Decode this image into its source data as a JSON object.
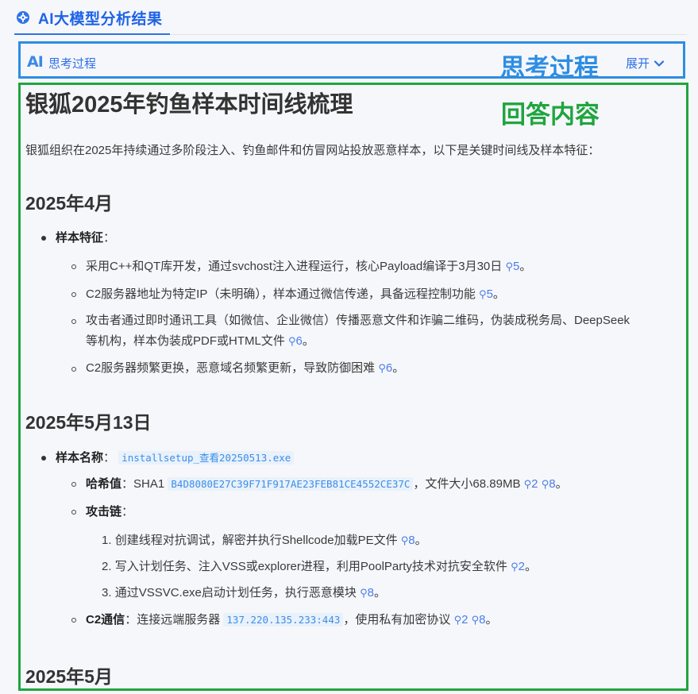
{
  "tab": {
    "title": "AI大模型分析结果",
    "icon": "gear-icon"
  },
  "thinking": {
    "ai_badge": "AI",
    "label": "思考过程",
    "annotation": "思考过程",
    "expand_label": "展开",
    "expand_icon": "chevron-down-icon"
  },
  "answer": {
    "annotation": "回答内容",
    "title": "银狐2025年钓鱼样本时间线梳理",
    "intro": "银狐组织在2025年持续通过多阶段注入、钓鱼邮件和仿冒网站投放恶意样本，以下是关键时间线及样本特征：",
    "sections": [
      {
        "heading": "2025年4月",
        "item_label": "样本特征",
        "items": [
          {
            "text": "采用C++和QT库开发，通过svchost注入进程运行，核心Payload编译于3月30日",
            "cites": [
              "5"
            ]
          },
          {
            "text": "C2服务器地址为特定IP（未明确），样本通过微信传递，具备远程控制功能",
            "cites": [
              "5"
            ]
          },
          {
            "text_line1": "攻击者通过即时通讯工具（如微信、企业微信）传播恶意文件和诈骗二维码，伪装成税务局、DeepSeek",
            "text_line2": "等机构，样本伪装成PDF或HTML文件",
            "cites": [
              "6"
            ]
          },
          {
            "text": "C2服务器频繁更换，恶意域名频繁更新，导致防御困难",
            "cites": [
              "6"
            ]
          }
        ]
      },
      {
        "heading": "2025年5月13日",
        "name_label": "样本名称",
        "name_value": "installsetup_查看20250513.exe",
        "hash_label": "哈希值",
        "hash_prefix": "SHA1",
        "hash_value": "B4D8080E27C39F71F917AE23FEB81CE4552CE37C",
        "hash_suffix": "，文件大小68.89MB",
        "hash_cites": [
          "2",
          "8"
        ],
        "chain_label": "攻击链",
        "chain": [
          {
            "num": "1.",
            "text": "创建线程对抗调试，解密并执行Shellcode加载PE文件",
            "cites": [
              "8"
            ]
          },
          {
            "num": "2.",
            "text": "写入计划任务、注入VSS或explorer进程，利用PoolParty技术对抗安全软件",
            "cites": [
              "2"
            ]
          },
          {
            "num": "3.",
            "text": "通过VSSVC.exe启动计划任务，执行恶意模块",
            "cites": [
              "8"
            ]
          }
        ],
        "c2_label": "C2通信",
        "c2_prefix": "连接远端服务器",
        "c2_value": "137.220.135.233:443",
        "c2_suffix": "，使用私有加密协议",
        "c2_cites": [
          "2",
          "8"
        ]
      },
      {
        "heading": "2025年5月"
      }
    ]
  },
  "colors": {
    "accent": "#1e63e6",
    "think_border": "#2d8de3",
    "answer_border": "#1fa53f",
    "code": "#3b8ee8"
  }
}
